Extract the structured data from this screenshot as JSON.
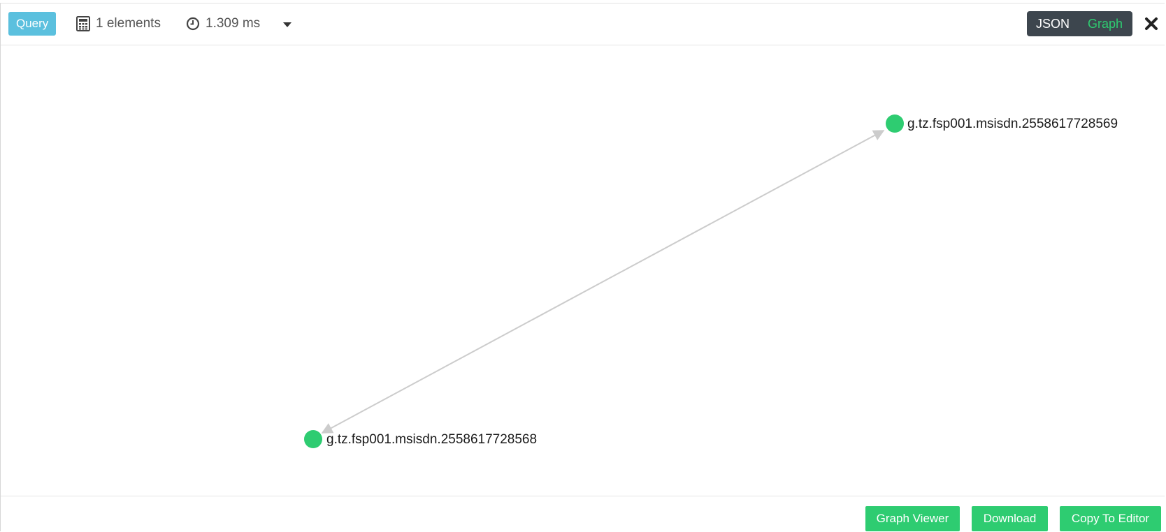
{
  "header": {
    "query_label": "Query",
    "elements_count": "1 elements",
    "elements_icon": "calculator-icon",
    "exec_time": "1.309 ms",
    "time_icon": "clock-icon",
    "dropdown_icon": "caret-down-icon",
    "view_toggle": {
      "json_label": "JSON",
      "graph_label": "Graph",
      "active": "Graph"
    },
    "close_icon": "close-icon"
  },
  "graph": {
    "node_color": "#2ecc71",
    "edge_color": "#cccccc",
    "nodes": [
      {
        "id": "n1",
        "label": "g.tz.fsp001.msisdn.2558617728569"
      },
      {
        "id": "n2",
        "label": "g.tz.fsp001.msisdn.2558617728568"
      }
    ],
    "edges": [
      {
        "from": "n1",
        "to": "n2",
        "directed": "both"
      }
    ]
  },
  "footer": {
    "graph_viewer_label": "Graph Viewer",
    "download_label": "Download",
    "copy_to_editor_label": "Copy To Editor"
  },
  "colors": {
    "query_badge": "#5bc0de",
    "accent": "#2ecc71",
    "toggle_bg": "#3d464e"
  }
}
